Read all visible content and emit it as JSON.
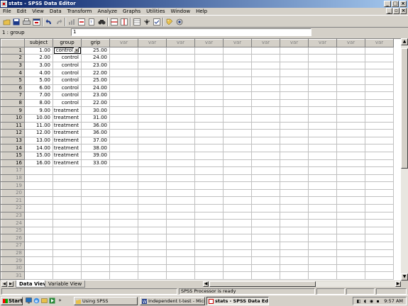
{
  "window": {
    "title": "stats - SPSS Data Editor"
  },
  "menu": [
    "File",
    "Edit",
    "View",
    "Data",
    "Transform",
    "Analyze",
    "Graphs",
    "Utilities",
    "Window",
    "Help"
  ],
  "cell_editor": {
    "reference": "1 : group",
    "value": "1"
  },
  "grid": {
    "columns": [
      "subject",
      "group",
      "grip",
      "var",
      "var",
      "var",
      "var",
      "var",
      "var",
      "var",
      "var",
      "var",
      "var"
    ],
    "rows": [
      [
        "1.00",
        "control",
        "25.00"
      ],
      [
        "2.00",
        "control",
        "24.00"
      ],
      [
        "3.00",
        "control",
        "23.00"
      ],
      [
        "4.00",
        "control",
        "22.00"
      ],
      [
        "5.00",
        "control",
        "25.00"
      ],
      [
        "6.00",
        "control",
        "24.00"
      ],
      [
        "7.00",
        "control",
        "23.00"
      ],
      [
        "8.00",
        "control",
        "22.00"
      ],
      [
        "9.00",
        "treatment",
        "30.00"
      ],
      [
        "10.00",
        "treatment",
        "31.00"
      ],
      [
        "11.00",
        "treatment",
        "36.00"
      ],
      [
        "12.00",
        "treatment",
        "36.00"
      ],
      [
        "13.00",
        "treatment",
        "37.00"
      ],
      [
        "14.00",
        "treatment",
        "38.00"
      ],
      [
        "15.00",
        "treatment",
        "39.00"
      ],
      [
        "16.00",
        "treatment",
        "33.00"
      ]
    ],
    "empty_row_numbers": [
      "17",
      "18",
      "19",
      "20",
      "21",
      "22",
      "23",
      "24",
      "25",
      "26",
      "27",
      "28",
      "29",
      "30",
      "31"
    ]
  },
  "tabs": {
    "data_view": "Data View",
    "variable_view": "Variable View"
  },
  "status": {
    "processor": "SPSS Processor  is ready"
  },
  "taskbar": {
    "start": "Start",
    "chevron": "»",
    "tasks": [
      "Using SPSS",
      "Independent t-test - Micr...",
      "stats - SPSS Data Editor"
    ],
    "clock": "9:57 AM"
  }
}
